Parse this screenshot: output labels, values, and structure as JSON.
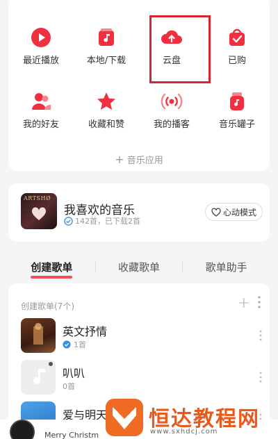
{
  "grid": {
    "row1": [
      {
        "label": "最近播放",
        "icon": "play-circle-icon"
      },
      {
        "label": "本地/下载",
        "icon": "music-file-icon"
      },
      {
        "label": "云盘",
        "icon": "cloud-upload-icon"
      },
      {
        "label": "已购",
        "icon": "shopping-bag-icon"
      }
    ],
    "row2": [
      {
        "label": "我的好友",
        "icon": "friends-icon"
      },
      {
        "label": "收藏和赞",
        "icon": "star-icon"
      },
      {
        "label": "我的播客",
        "icon": "podcast-icon"
      },
      {
        "label": "音乐罐子",
        "icon": "music-jar-icon"
      }
    ],
    "more_label": "音乐应用"
  },
  "favorite": {
    "cover_text": "ARTSHØ",
    "title": "我喜欢的音乐",
    "subtitle": "142首，已下载2首",
    "mode_button": "心动模式"
  },
  "tabs": [
    {
      "label": "创建歌单",
      "active": true
    },
    {
      "label": "收藏歌单",
      "active": false
    },
    {
      "label": "歌单助手",
      "active": false
    }
  ],
  "playlists": {
    "header": "创建歌单(7个)",
    "items": [
      {
        "title": "英文抒情",
        "subtitle": "1首"
      },
      {
        "title": "叭叭",
        "subtitle": "0首"
      },
      {
        "title": "爱与明天",
        "subtitle": ""
      }
    ]
  },
  "player": {
    "title": "Merry Christm"
  },
  "watermark": {
    "text": "恒达教程网",
    "url": "www.sxhdcj.com"
  },
  "colors": {
    "accent": "#f0303e",
    "highlight_box": "#d9262c",
    "watermark": "#ea5a1c"
  }
}
